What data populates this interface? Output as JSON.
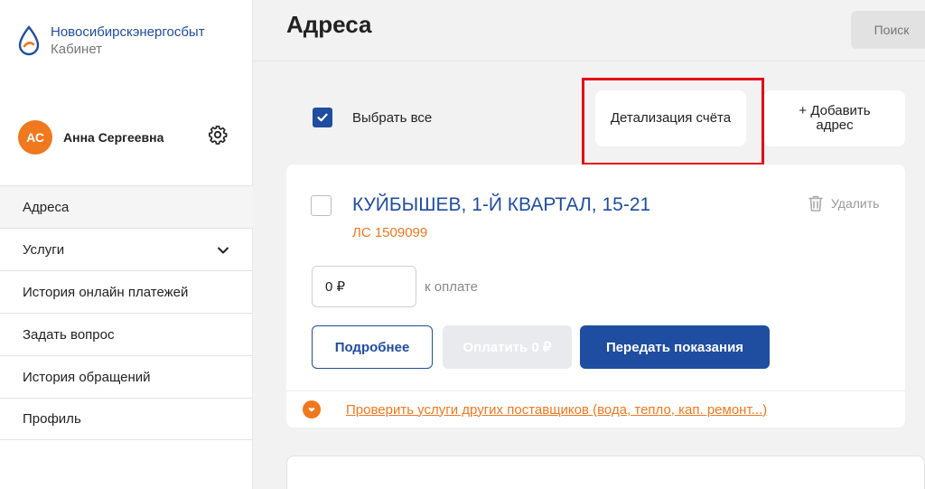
{
  "brand": {
    "name": "Новосибирскэнергосбыт",
    "subtitle": "Кабинет",
    "logo_icon": "drop-logo-icon"
  },
  "user": {
    "initials": "АС",
    "name": "Анна Сергеевна",
    "avatar_color": "#f0781e",
    "settings_icon": "gear-icon"
  },
  "menu": {
    "items": [
      {
        "label": "Адреса",
        "active": true
      },
      {
        "label": "Услуги",
        "has_chevron": true
      },
      {
        "label": "История онлайн платежей"
      },
      {
        "label": "Задать вопрос"
      },
      {
        "label": "История обращений"
      },
      {
        "label": "Профиль"
      }
    ]
  },
  "header": {
    "title": "Адреса",
    "search_label": "Поиск"
  },
  "toolbar": {
    "select_all_label": "Выбрать все",
    "select_all_checked": true,
    "detail_button_label": "Детализация счёта",
    "add_address_label": "+ Добавить адрес"
  },
  "address_card": {
    "title": "КУЙБЫШЕВ, 1-Й КВАРТАЛ, 15-21",
    "account": "ЛС 1509099",
    "delete_label": "Удалить",
    "amount_value": "0 ₽",
    "to_pay_label": "к оплате",
    "more_button": "Подробнее",
    "pay_button": "Оплатить 0 ₽",
    "readings_button": "Передать показания",
    "check_other_link": "Проверить услуги других поставщиков (вода, тепло, кап. ремонт...)"
  },
  "colors": {
    "primary": "#1f4da0",
    "accent": "#f0781e",
    "highlight": "#e30b17"
  }
}
